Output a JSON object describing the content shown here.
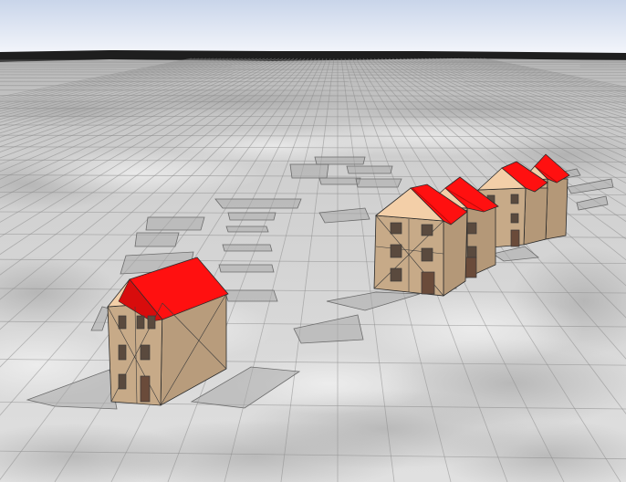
{
  "scene": {
    "view": "3d-terrain-viewport",
    "colors": {
      "sky_top": "#c9d5ea",
      "sky_bottom": "#f4f6fb",
      "horizon_dark": "#1a1a1a",
      "ground": "#d9d9d9",
      "ground_dark": "#9a9a9a",
      "grid_line": "#8a8a8a",
      "roof_red": "#ff1010",
      "roof_shadow": "#b80a0a",
      "wall_front": "#c7aa88",
      "wall_side": "#b89c7c",
      "gable": "#f3cfa8",
      "footprint": "#a9a9a9",
      "window": "#5a4a3e"
    },
    "houses": [
      {
        "name": "house-front-left"
      },
      {
        "name": "house-row-1"
      },
      {
        "name": "house-row-2"
      },
      {
        "name": "house-row-3"
      },
      {
        "name": "house-row-4"
      }
    ]
  }
}
